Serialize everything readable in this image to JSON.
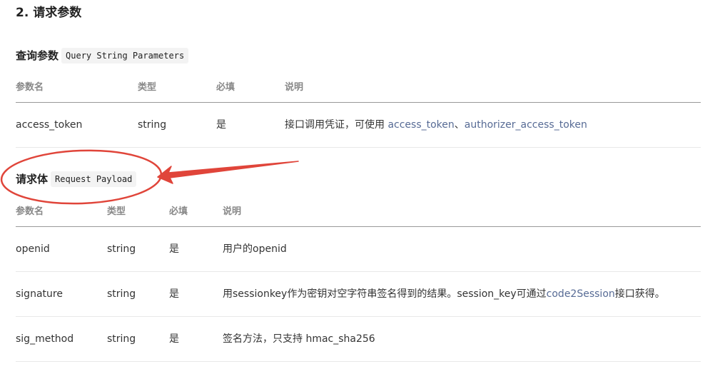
{
  "section": {
    "title": "2. 请求参数"
  },
  "query": {
    "title": "查询参数",
    "code": "Query String Parameters",
    "headers": [
      "参数名",
      "类型",
      "必填",
      "说明"
    ],
    "rows": [
      {
        "name": "access_token",
        "type": "string",
        "required": "是",
        "desc_prefix": "接口调用凭证，可使用 ",
        "link1": "access_token",
        "sep": "、",
        "link2": "authorizer_access_token"
      }
    ]
  },
  "payload": {
    "title": "请求体",
    "code": "Request Payload",
    "headers": [
      "参数名",
      "类型",
      "必填",
      "说明"
    ],
    "rows": [
      {
        "name": "openid",
        "type": "string",
        "required": "是",
        "desc": "用户的openid"
      },
      {
        "name": "signature",
        "type": "string",
        "required": "是",
        "desc_prefix": "用sessionkey作为密钥对空字符串签名得到的结果。session_key可通过",
        "link": "code2Session",
        "desc_suffix": "接口获得。"
      },
      {
        "name": "sig_method",
        "type": "string",
        "required": "是",
        "desc": "签名方法，只支持 hmac_sha256"
      }
    ]
  },
  "colors": {
    "link": "#576b95",
    "annotation": "#e0453a"
  }
}
